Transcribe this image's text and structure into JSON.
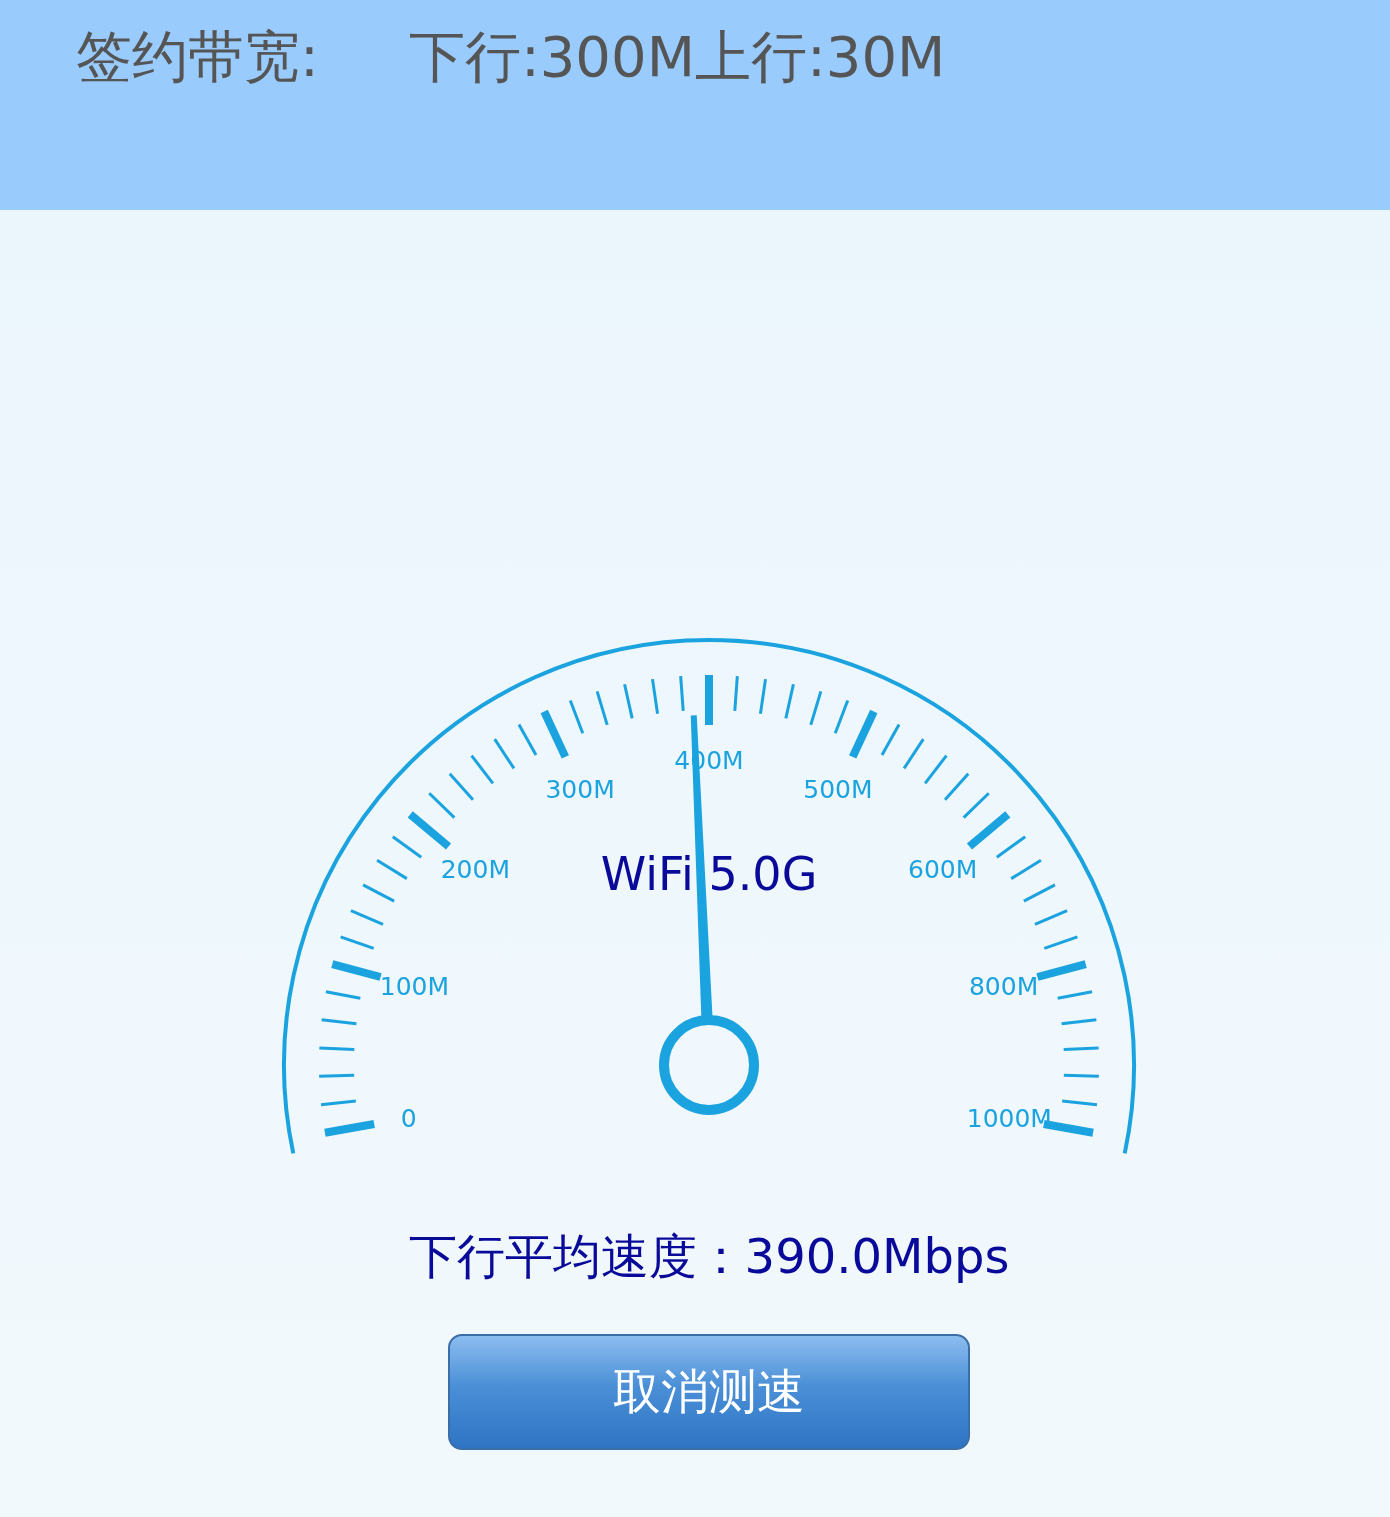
{
  "header": {
    "label": "签约带宽:",
    "value": "下行:300M上行:30M"
  },
  "gauge": {
    "title": "WiFi 5.0G",
    "scale_labels": [
      "0",
      "100M",
      "200M",
      "300M",
      "400M",
      "500M",
      "600M",
      "800M",
      "1000M"
    ]
  },
  "reading": "下行平均速度：390.0Mbps",
  "buttons": [
    "取消测速"
  ]
}
